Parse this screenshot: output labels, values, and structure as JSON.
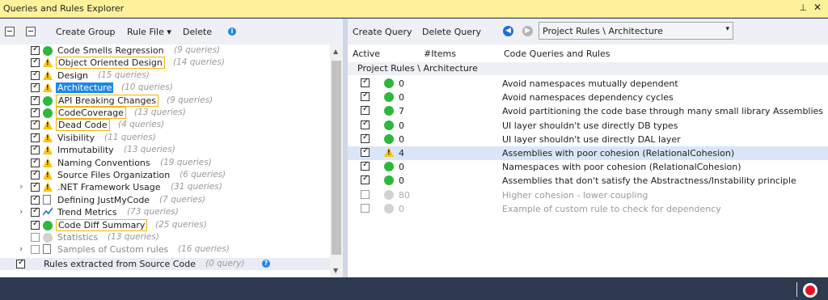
{
  "window": {
    "title": "Queries and Rules Explorer",
    "pin_glyph": "⊥",
    "close_glyph": "✕"
  },
  "left_toolbar": {
    "create_group": "Create Group",
    "rule_file": "Rule File ▾",
    "delete": "Delete",
    "info_glyph": "i"
  },
  "tree": [
    {
      "label": "Code Smells Regression",
      "count": "(9 queries)",
      "checked": true,
      "status": "green",
      "boxed": false
    },
    {
      "label": "Object Oriented Design",
      "count": "(14 queries)",
      "checked": true,
      "status": "warning",
      "boxed": true
    },
    {
      "label": "Design",
      "count": "(15 queries)",
      "checked": true,
      "status": "warning",
      "boxed": false
    },
    {
      "label": "Architecture",
      "count": "(10 queries)",
      "checked": true,
      "status": "warning",
      "boxed": false,
      "selected": true
    },
    {
      "label": "API Breaking Changes",
      "count": "(9 queries)",
      "checked": true,
      "status": "green",
      "boxed": true
    },
    {
      "label": "CodeCoverage",
      "count": "(13 queries)",
      "checked": true,
      "status": "green",
      "boxed": true
    },
    {
      "label": "Dead Code",
      "count": "(4 queries)",
      "checked": true,
      "status": "warning",
      "boxed": true
    },
    {
      "label": "Visibility",
      "count": "(11 queries)",
      "checked": true,
      "status": "warning",
      "boxed": false
    },
    {
      "label": "Immutability",
      "count": "(13 queries)",
      "checked": true,
      "status": "warning",
      "boxed": false
    },
    {
      "label": "Naming Conventions",
      "count": "(19 queries)",
      "checked": true,
      "status": "warning",
      "boxed": false
    },
    {
      "label": "Source Files Organization",
      "count": "(6 queries)",
      "checked": true,
      "status": "warning",
      "boxed": false
    },
    {
      "label": ".NET Framework Usage",
      "count": "(31 queries)",
      "checked": true,
      "status": "warning",
      "boxed": false,
      "expandable": true
    },
    {
      "label": "Defining JustMyCode",
      "count": "(7 queries)",
      "checked": true,
      "status": "doc",
      "boxed": false
    },
    {
      "label": "Trend Metrics",
      "count": "(73 queries)",
      "checked": true,
      "status": "trend",
      "boxed": false,
      "expandable": true
    },
    {
      "label": "Code Diff Summary",
      "count": "(25 queries)",
      "checked": true,
      "status": "green",
      "boxed": true
    },
    {
      "label": "Statistics",
      "count": "(13 queries)",
      "checked": false,
      "status": "grey",
      "boxed": false,
      "disabled": true
    },
    {
      "label": "Samples of Custom rules",
      "count": "(16 queries)",
      "checked": false,
      "status": "doc",
      "boxed": false,
      "disabled": true,
      "expandable": true
    }
  ],
  "extracted": {
    "label": "Rules extracted from Source Code",
    "count": "(0 query)",
    "help_glyph": "?"
  },
  "right_toolbar": {
    "create_query": "Create Query",
    "delete_query": "Delete Query",
    "back_glyph": "◀",
    "forward_glyph": "▶",
    "combo_value": "Project Rules \\ Architecture",
    "combo_arrow": "▾"
  },
  "columns": {
    "active": "Active",
    "items": "#Items",
    "name": "Code Queries and Rules"
  },
  "group_header": "Project Rules \\ Architecture",
  "rules": [
    {
      "items": "0",
      "name": "Avoid namespaces mutually dependent",
      "checked": true,
      "status": "green"
    },
    {
      "items": "0",
      "name": "Avoid namespaces dependency cycles",
      "checked": true,
      "status": "green"
    },
    {
      "items": "7",
      "name": "Avoid partitioning the code base through many small library Assemblies",
      "checked": true,
      "status": "green"
    },
    {
      "items": "0",
      "name": "UI layer shouldn't use directly DB types",
      "checked": true,
      "status": "green"
    },
    {
      "items": "0",
      "name": "UI layer shouldn't use directly DAL layer",
      "checked": true,
      "status": "green"
    },
    {
      "items": "4",
      "name": "Assemblies with poor cohesion (RelationalCohesion)",
      "checked": true,
      "status": "warning",
      "highlight": true
    },
    {
      "items": "0",
      "name": "Namespaces with poor cohesion (RelationalCohesion)",
      "checked": true,
      "status": "green"
    },
    {
      "items": "0",
      "name": "Assemblies that don't satisfy the Abstractness/Instability principle",
      "checked": true,
      "status": "green"
    },
    {
      "items": "80",
      "name": "Higher cohesion - lower coupling",
      "checked": false,
      "status": "grey",
      "dim": true
    },
    {
      "items": "0",
      "name": "Example of custom rule to check for dependency",
      "checked": false,
      "status": "grey",
      "dim": true
    }
  ],
  "colors": {
    "titlebar": "#fff29d",
    "selection": "#1e88e5",
    "ok": "#2db83d",
    "warning": "#f5c518",
    "record": "#e81123",
    "statusbar": "#2d3a50"
  }
}
